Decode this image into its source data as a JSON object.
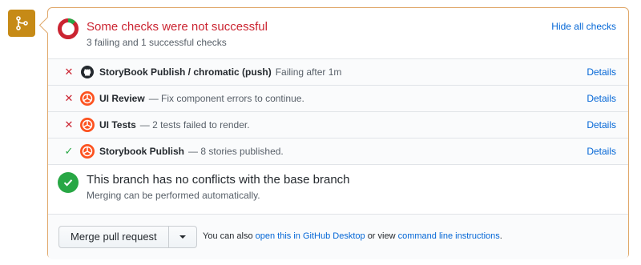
{
  "status": {
    "title": "Some checks were not successful",
    "subtitle": "3 failing and 1 successful checks",
    "hide_link": "Hide all checks",
    "colors": {
      "fail": "#cb2431",
      "pass": "#28a745",
      "warning_border": "#e0a86a",
      "merge_icon_bg": "#c68a16"
    }
  },
  "checks": [
    {
      "state": "fail",
      "app_icon": "github-icon",
      "name": "StoryBook Publish / chromatic (push)",
      "description": "Failing after 1m",
      "details": "Details"
    },
    {
      "state": "fail",
      "app_icon": "chromatic-icon",
      "name": "UI Review",
      "description": "— Fix component errors to continue.",
      "details": "Details"
    },
    {
      "state": "fail",
      "app_icon": "chromatic-icon",
      "name": "UI Tests",
      "description": "— 2 tests failed to render.",
      "details": "Details"
    },
    {
      "state": "pass",
      "app_icon": "chromatic-icon",
      "name": "Storybook Publish",
      "description": "— 8 stories published.",
      "details": "Details"
    }
  ],
  "conflicts": {
    "title": "This branch has no conflicts with the base branch",
    "subtitle": "Merging can be performed automatically."
  },
  "merge": {
    "button_label": "Merge pull request",
    "note_prefix": "You can also",
    "desktop_link": "open this in GitHub Desktop",
    "note_middle": "or view",
    "cli_link": "command line instructions",
    "note_suffix": "."
  }
}
